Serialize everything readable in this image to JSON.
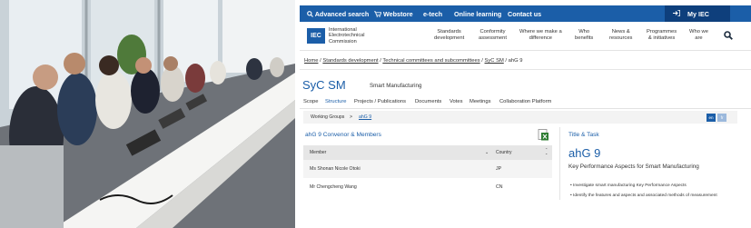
{
  "topbar": {
    "advanced_search": "Advanced search",
    "webstore": "Webstore",
    "etech": "e-tech",
    "online_learning": "Online learning",
    "contact_us": "Contact us",
    "my_iec": "My IEC"
  },
  "header": {
    "logo": "IEC",
    "org_line1": "International",
    "org_line2": "Electrotechnical",
    "org_line3": "Commission",
    "nav": [
      {
        "l1": "Standards",
        "l2": "development"
      },
      {
        "l1": "Conformity",
        "l2": "assessment"
      },
      {
        "l1": "Where we make a",
        "l2": "difference"
      },
      {
        "l1": "Who",
        "l2": "benefits"
      },
      {
        "l1": "News &",
        "l2": "resources"
      },
      {
        "l1": "Programmes",
        "l2": "& initiatives"
      },
      {
        "l1": "Who we",
        "l2": "are"
      }
    ]
  },
  "breadcrumb": {
    "home": "Home",
    "standards": "Standards development",
    "committees": "Technical committees and subcommittees",
    "syc": "SyC SM",
    "current": "ahG 9",
    "sep": "/"
  },
  "committee": {
    "code": "SyC SM",
    "name": "Smart Manufacturing"
  },
  "tabs": [
    "Scope",
    "Structure",
    "Projects / Publications",
    "Documents",
    "Votes",
    "Meetings",
    "Collaboration Platform"
  ],
  "subnav": {
    "working_groups": "Working Groups",
    "arrow": ">",
    "current": "ahG 9",
    "lang_en": "en",
    "lang_fr": "fr"
  },
  "convenor": {
    "title": "ahG 9 Convenor & Members",
    "col_member": "Member",
    "col_country": "Country",
    "rows": [
      {
        "member": "Ms Shonan Nicole Otoki",
        "country": "JP"
      },
      {
        "member": "Mr Chengcheng Wang",
        "country": "CN"
      }
    ]
  },
  "task": {
    "section": "Title & Task",
    "code": "ahG 9",
    "title": "Key Performance Aspects for Smart Manufacturing",
    "bullets": [
      "Investigate smart manufacturing Key Performance Aspects",
      "Identify the features and aspects and associated methods of measurement"
    ]
  },
  "colors": {
    "brand_blue": "#1b5ea8",
    "dark_blue": "#0e3f7c"
  }
}
